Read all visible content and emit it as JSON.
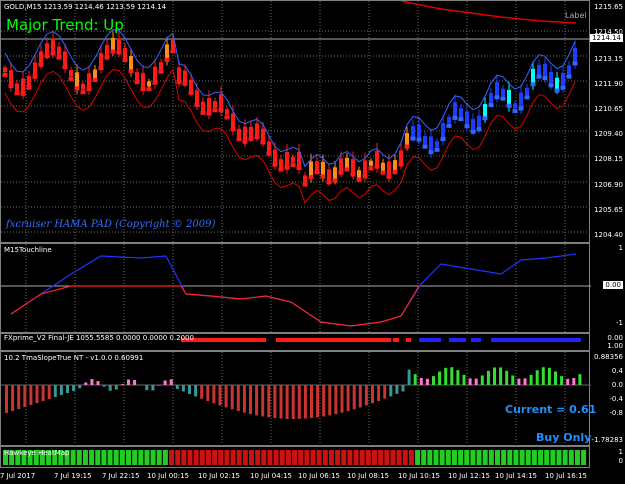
{
  "main": {
    "header": "GOLD,M15  1213.59 1214.46 1213.59 1214.14",
    "trend": "Major Trend: Up",
    "label_tag": "Label",
    "watermark": "fxcruiser HAMA PAD (Copyright © 2009)",
    "price_box": "1214.14",
    "y_ticks": [
      "1215.65",
      "1214.50",
      "1213.15",
      "1211.90",
      "1210.65",
      "1209.40",
      "1208.15",
      "1206.90",
      "1205.65",
      "1204.40"
    ]
  },
  "touchline": {
    "title": "M15Touchline",
    "y_ticks": [
      "1",
      "0.00",
      "-1"
    ]
  },
  "fxprime": {
    "title": "FXprime_V2 Final-JE 1055.5585 0.0000 0.0000 0.2000",
    "y_ticks": [
      "0.00",
      "1.00"
    ]
  },
  "tma": {
    "title": "10.2 TmaSlopeTrue NT   - v1.0.0      0.60991",
    "current": "Current = 0.61",
    "signal": "Buy Only",
    "y_ticks": [
      "0.88356",
      "0.4",
      "0.0",
      "-0.4",
      "-0.8",
      "-1.78283"
    ]
  },
  "hawkeye": {
    "title": "Hawkeye HeatMap",
    "y_ticks": [
      "1",
      "0"
    ]
  },
  "x_axis": [
    "7 Jul 2017",
    "7 Jul 19:15",
    "7 Jul 22:15",
    "10 Jul 00:15",
    "10 Jul 02:15",
    "10 Jul 04:15",
    "10 Jul 06:15",
    "10 Jul 08:15",
    "10 Jul 10:15",
    "10 Jul 12:15",
    "10 Jul 14:15",
    "10 Jul 16:15"
  ],
  "colors": {
    "bull": "#1f3dff",
    "bear": "#ff1a1a",
    "orange": "#ff8c1a",
    "cyan": "#00ffff",
    "green": "#33dd33",
    "teal": "#339999",
    "pink": "#ff77cc",
    "band_blue": "#3366ff",
    "band_red": "#e00000"
  }
}
